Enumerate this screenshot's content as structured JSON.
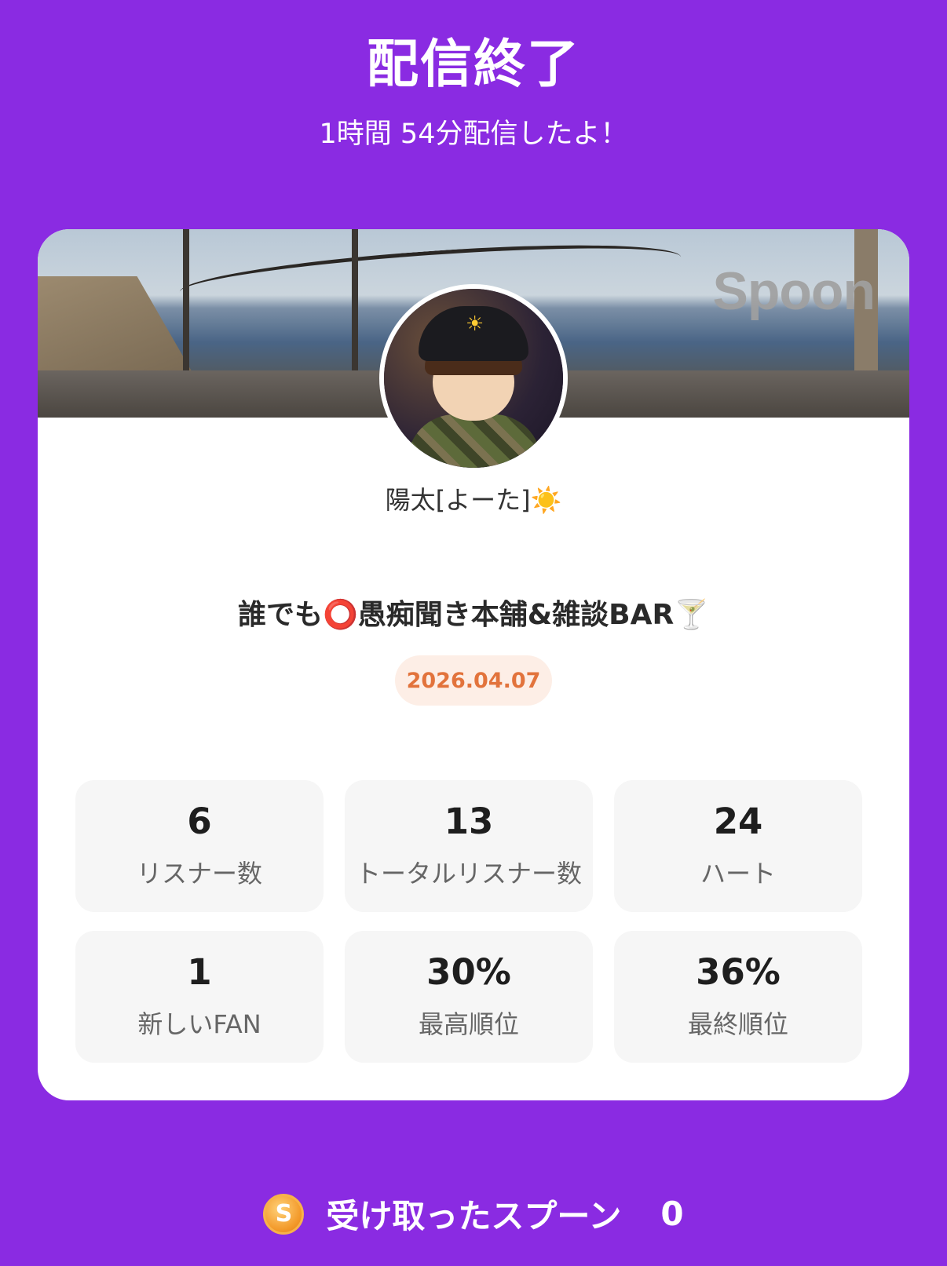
{
  "header": {
    "title": "配信終了",
    "subtitle": "1時間 54分配信したよ！"
  },
  "card": {
    "watermark": "Spoon",
    "user_name": "陽太[よーた]☀️",
    "broadcast_title": "誰でも⭕️愚痴聞き本舗&雑談BAR🍸",
    "date": "2026.04.07",
    "stats": [
      {
        "value": "6",
        "label": "リスナー数"
      },
      {
        "value": "13",
        "label": "トータルリスナー数"
      },
      {
        "value": "24",
        "label": "ハート"
      },
      {
        "value": "1",
        "label": "新しいFAN"
      },
      {
        "value": "30%",
        "label": "最高順位"
      },
      {
        "value": "36%",
        "label": "最終順位"
      }
    ]
  },
  "footer": {
    "coin_glyph": "S",
    "received_label": "受け取ったスプーン",
    "received_count": "0"
  },
  "colors": {
    "background": "#8a2be2",
    "card": "#ffffff",
    "date_badge_bg": "#fdeee6",
    "date_badge_text": "#e2733c",
    "stat_bg": "#f6f6f6"
  }
}
